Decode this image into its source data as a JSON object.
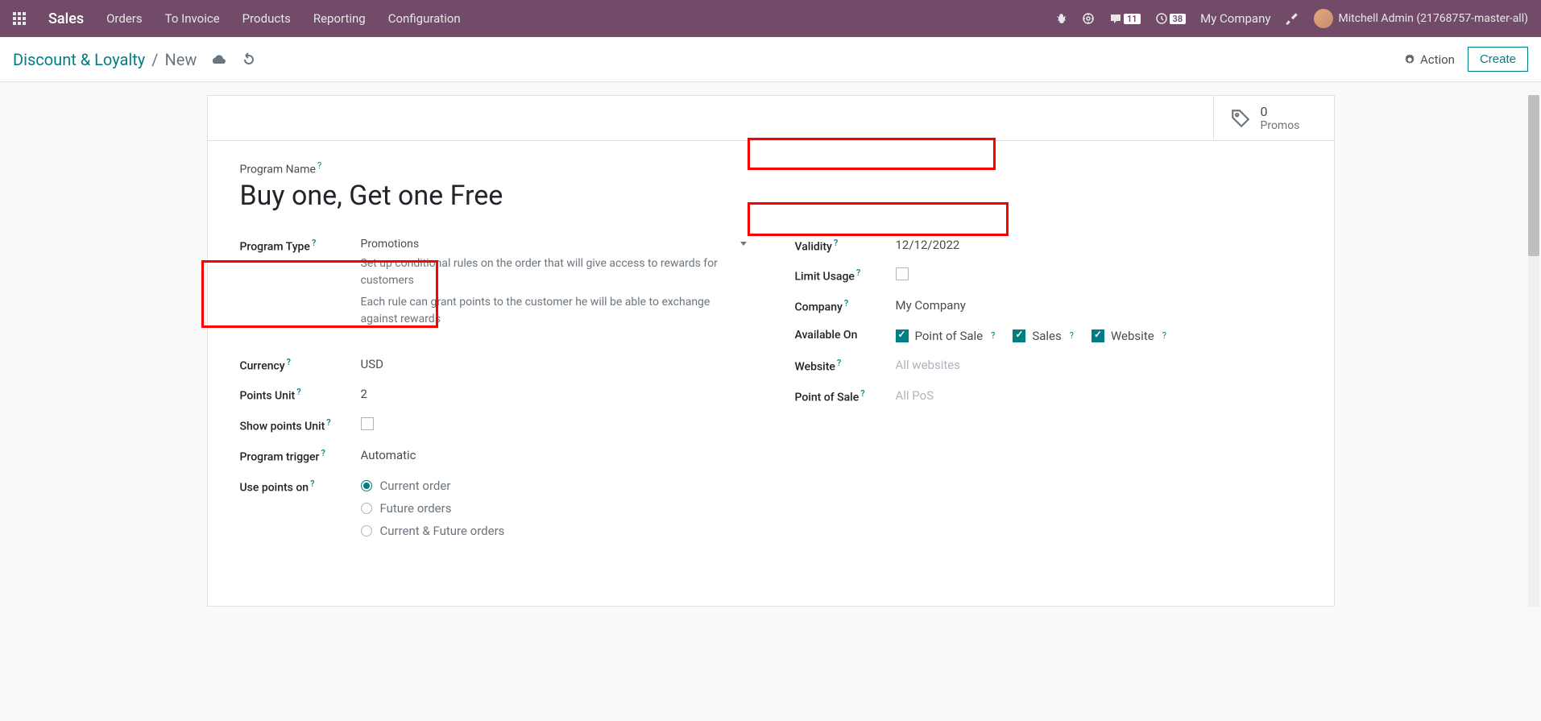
{
  "topbar": {
    "app_name": "Sales",
    "nav": [
      "Orders",
      "To Invoice",
      "Products",
      "Reporting",
      "Configuration"
    ],
    "messages_badge": "11",
    "activities_badge": "38",
    "company": "My Company",
    "user": "Mitchell Admin (21768757-master-all)"
  },
  "breadcrumb": {
    "parent": "Discount & Loyalty",
    "current": "New",
    "action_label": "Action",
    "create_label": "Create"
  },
  "stat": {
    "value": "0",
    "label": "Promos"
  },
  "form": {
    "program_name_label": "Program Name",
    "program_name_value": "Buy one, Get one Free",
    "program_type_label": "Program Type",
    "program_type_value": "Promotions",
    "program_type_help1": "Set up conditional rules on the order that will give access to rewards for customers",
    "program_type_help2": "Each rule can grant points to the customer he will be able to exchange against rewards",
    "currency_label": "Currency",
    "currency_value": "USD",
    "points_unit_label": "Points Unit",
    "points_unit_value": "2",
    "show_points_label": "Show points Unit",
    "program_trigger_label": "Program trigger",
    "program_trigger_value": "Automatic",
    "use_points_label": "Use points on",
    "use_points_options": [
      "Current order",
      "Future orders",
      "Current & Future orders"
    ],
    "validity_label": "Validity",
    "validity_value": "12/12/2022",
    "limit_usage_label": "Limit Usage",
    "company_label": "Company",
    "company_value": "My Company",
    "available_on_label": "Available On",
    "available_on_options": [
      "Point of Sale",
      "Sales",
      "Website"
    ],
    "website_label": "Website",
    "website_placeholder": "All websites",
    "pos_label": "Point of Sale",
    "pos_placeholder": "All PoS"
  }
}
